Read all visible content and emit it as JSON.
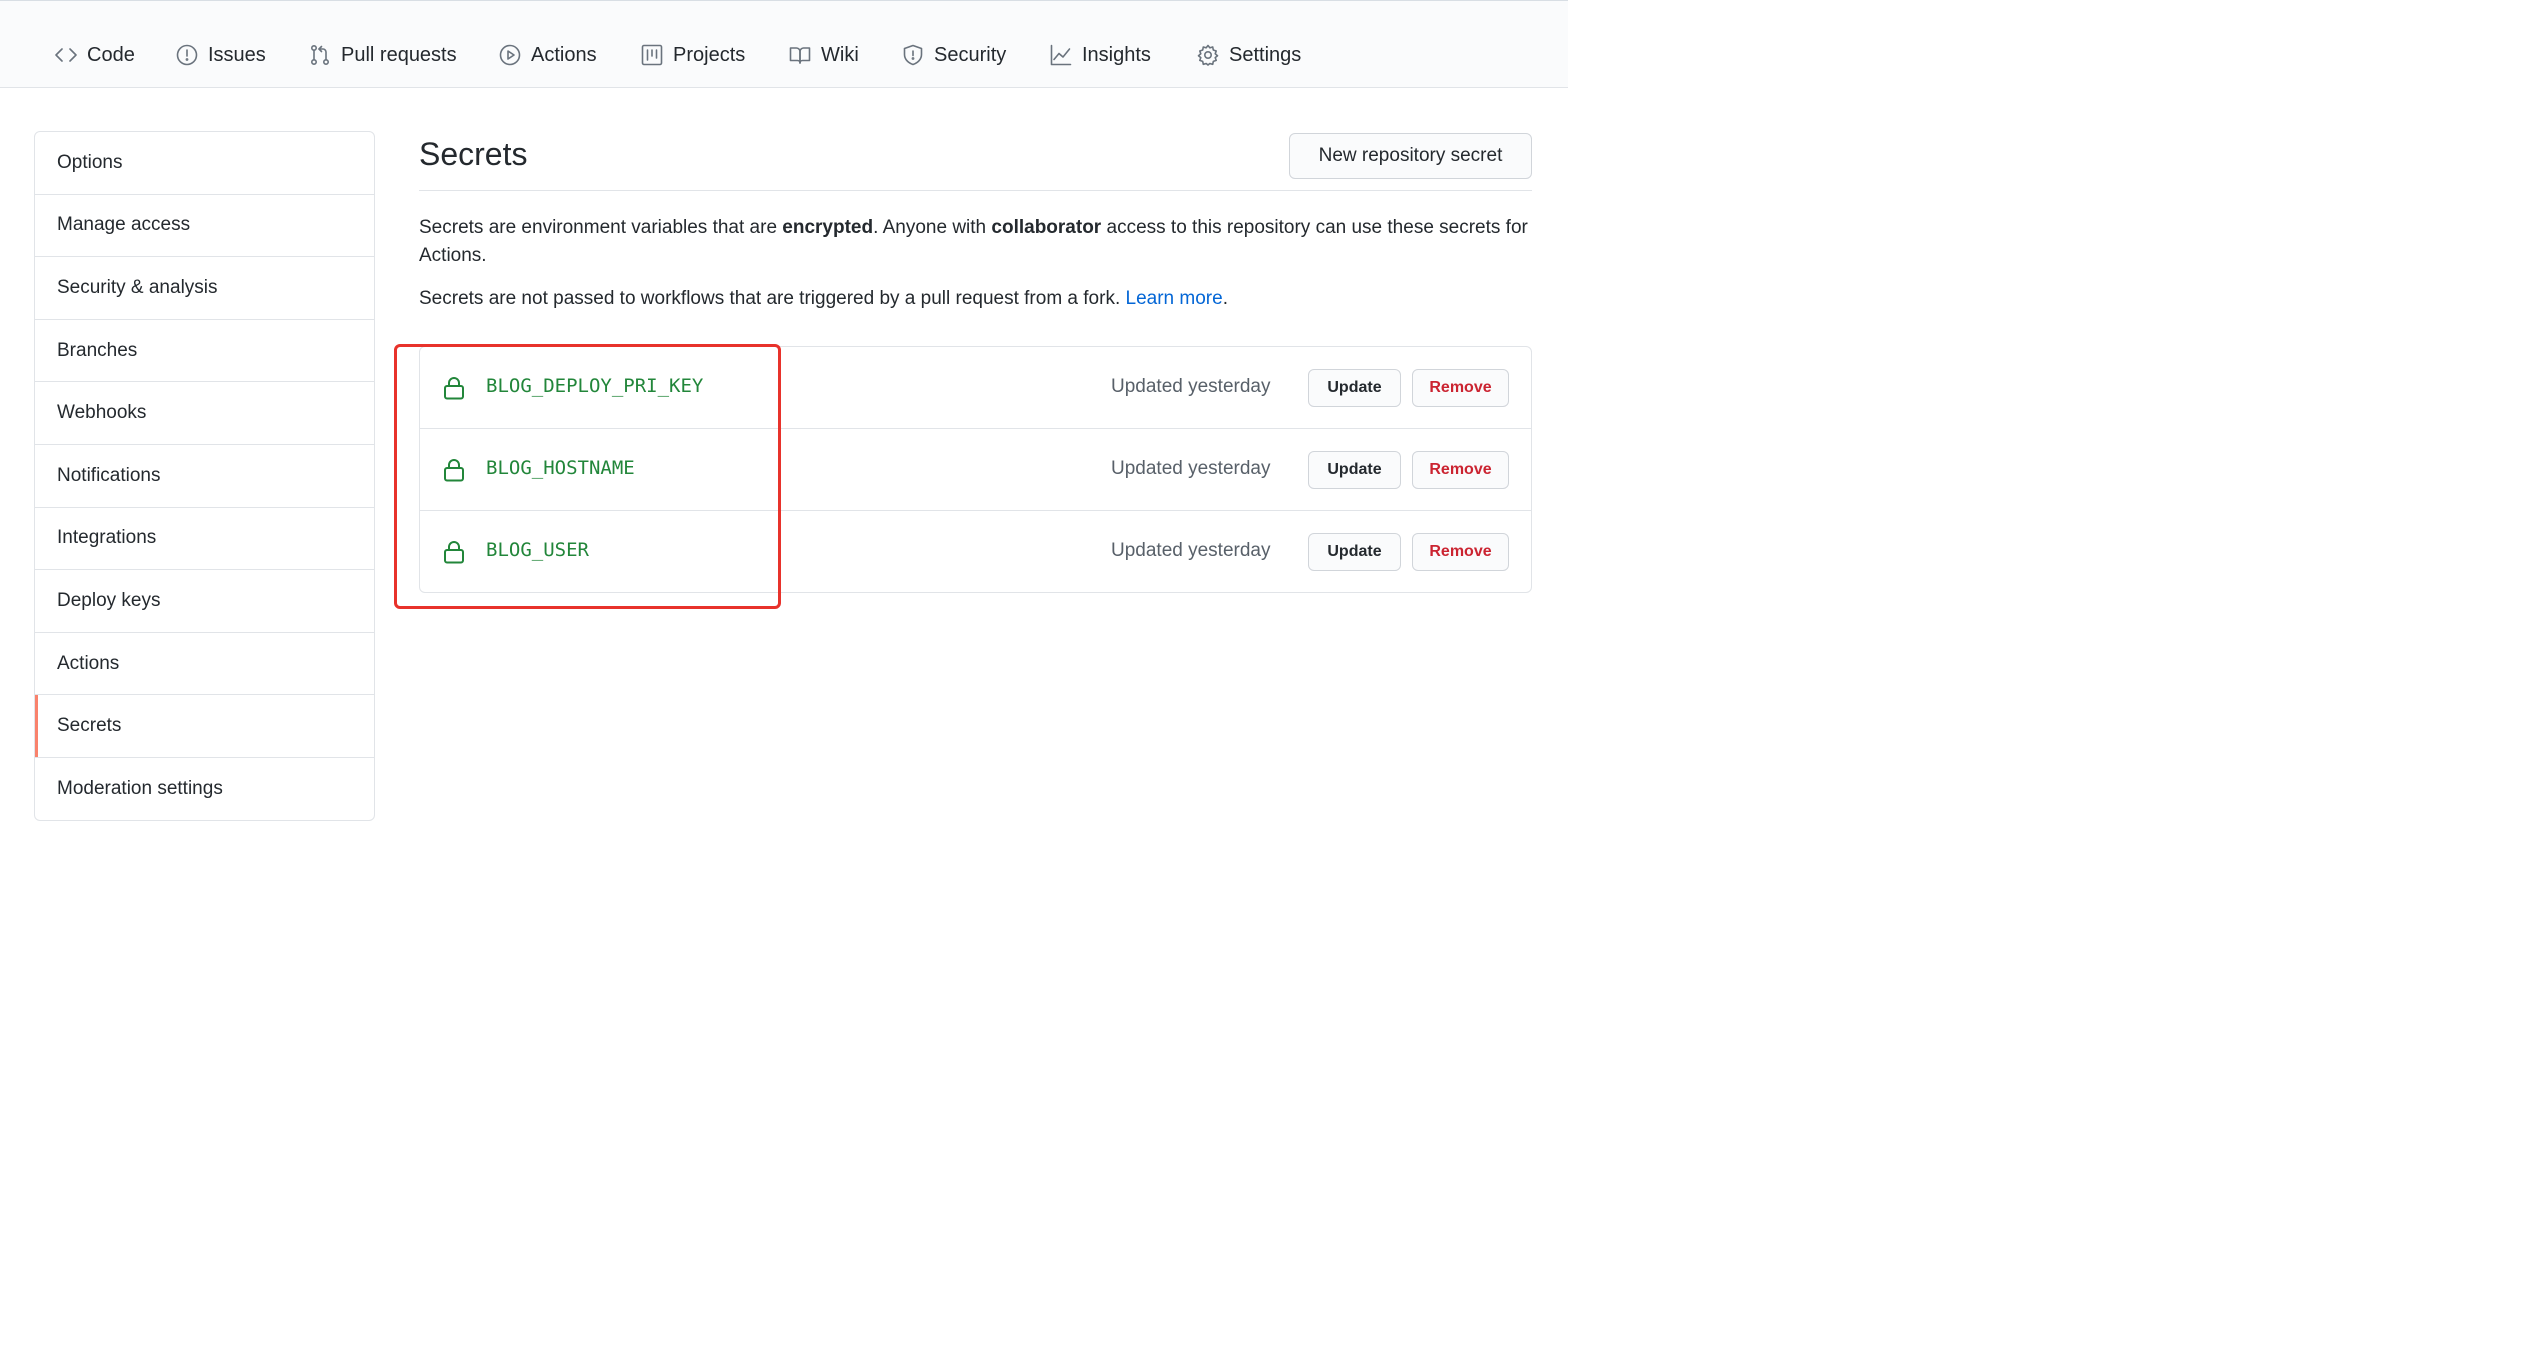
{
  "repo_nav": {
    "items": [
      {
        "label": "Code",
        "icon": "code-icon"
      },
      {
        "label": "Issues",
        "icon": "issue-opened-icon"
      },
      {
        "label": "Pull requests",
        "icon": "git-pull-request-icon"
      },
      {
        "label": "Actions",
        "icon": "play-icon"
      },
      {
        "label": "Projects",
        "icon": "project-icon"
      },
      {
        "label": "Wiki",
        "icon": "book-icon"
      },
      {
        "label": "Security",
        "icon": "shield-icon"
      },
      {
        "label": "Insights",
        "icon": "graph-icon"
      },
      {
        "label": "Settings",
        "icon": "gear-icon"
      }
    ]
  },
  "sidebar": {
    "items": [
      {
        "label": "Options"
      },
      {
        "label": "Manage access"
      },
      {
        "label": "Security & analysis"
      },
      {
        "label": "Branches"
      },
      {
        "label": "Webhooks"
      },
      {
        "label": "Notifications"
      },
      {
        "label": "Integrations"
      },
      {
        "label": "Deploy keys"
      },
      {
        "label": "Actions"
      },
      {
        "label": "Secrets",
        "selected": true
      },
      {
        "label": "Moderation settings"
      }
    ],
    "selected_accent": "#f9826c"
  },
  "main": {
    "title": "Secrets",
    "new_button_label": "New repository secret",
    "description1": {
      "part1": "Secrets are environment variables that are ",
      "bold1": "encrypted",
      "part2": ". Anyone with ",
      "bold2": "collaborator",
      "part3": " access to this repository can use these secrets for Actions."
    },
    "description2": {
      "text": "Secrets are not passed to workflows that are triggered by a pull request from a fork. ",
      "link": "Learn more",
      "end": "."
    },
    "secrets": [
      {
        "name": "BLOG_DEPLOY_PRI_KEY",
        "updated": "Updated yesterday",
        "update_label": "Update",
        "remove_label": "Remove",
        "icon": "lock-icon"
      },
      {
        "name": "BLOG_HOSTNAME",
        "updated": "Updated yesterday",
        "update_label": "Update",
        "remove_label": "Remove",
        "icon": "lock-icon"
      },
      {
        "name": "BLOG_USER",
        "updated": "Updated yesterday",
        "update_label": "Update",
        "remove_label": "Remove",
        "icon": "lock-icon"
      }
    ]
  },
  "colors": {
    "secret_name": "#22863a",
    "link": "#0366d6",
    "danger": "#cb2431",
    "annotation_box": "#e8322b"
  }
}
